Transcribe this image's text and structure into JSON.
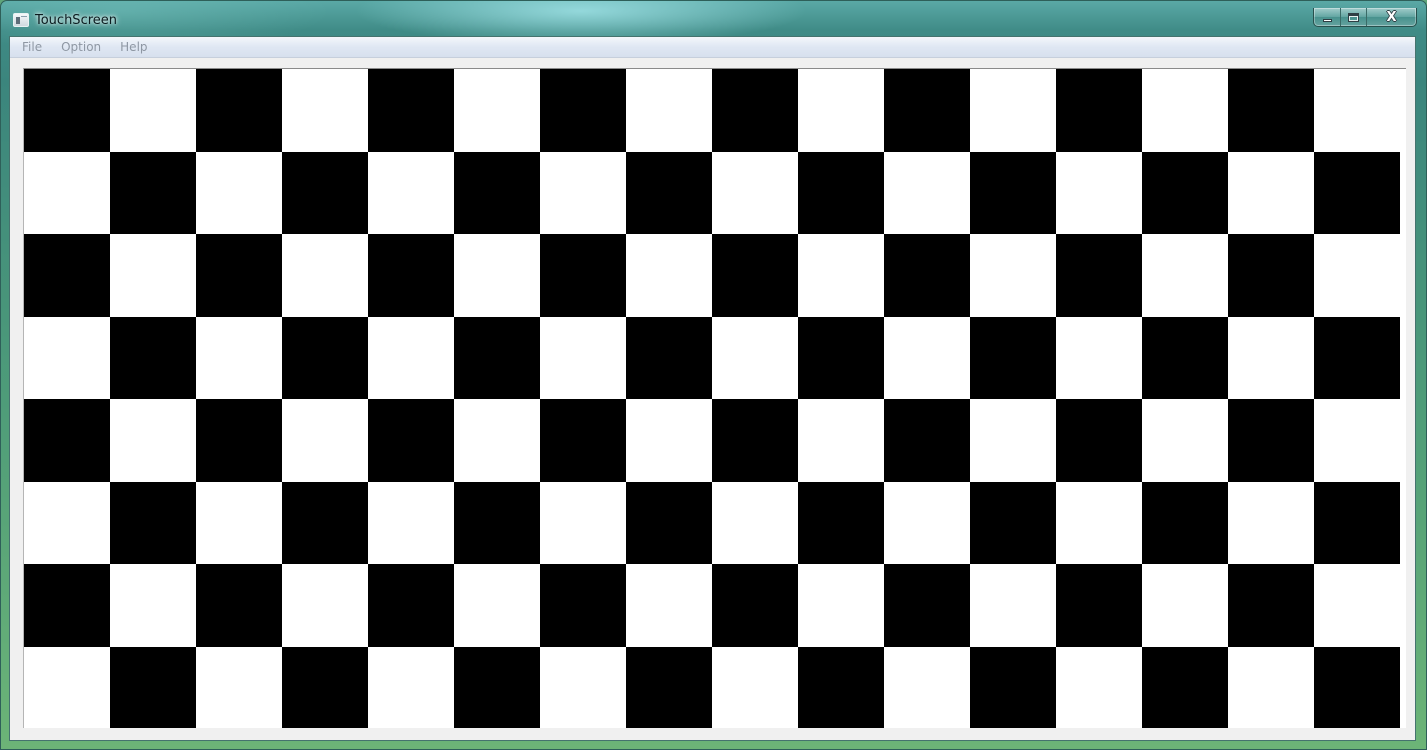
{
  "window": {
    "title": "TouchScreen",
    "controls": {
      "minimize_icon": "minimize-icon",
      "maximize_icon": "maximize-icon",
      "close_symbol": "X"
    }
  },
  "menu": {
    "items": [
      {
        "label": "File"
      },
      {
        "label": "Option"
      },
      {
        "label": "Help"
      }
    ]
  },
  "board": {
    "rows": 8,
    "columns": 16,
    "first_square_color": "#000000",
    "dark_color": "#000000",
    "light_color": "#ffffff"
  },
  "colors": {
    "title_glass": "#3f8b86",
    "menubar": "#dfe7f3",
    "menu_text_disabled": "#8e97a3",
    "client_background": "#f0f0f0"
  }
}
